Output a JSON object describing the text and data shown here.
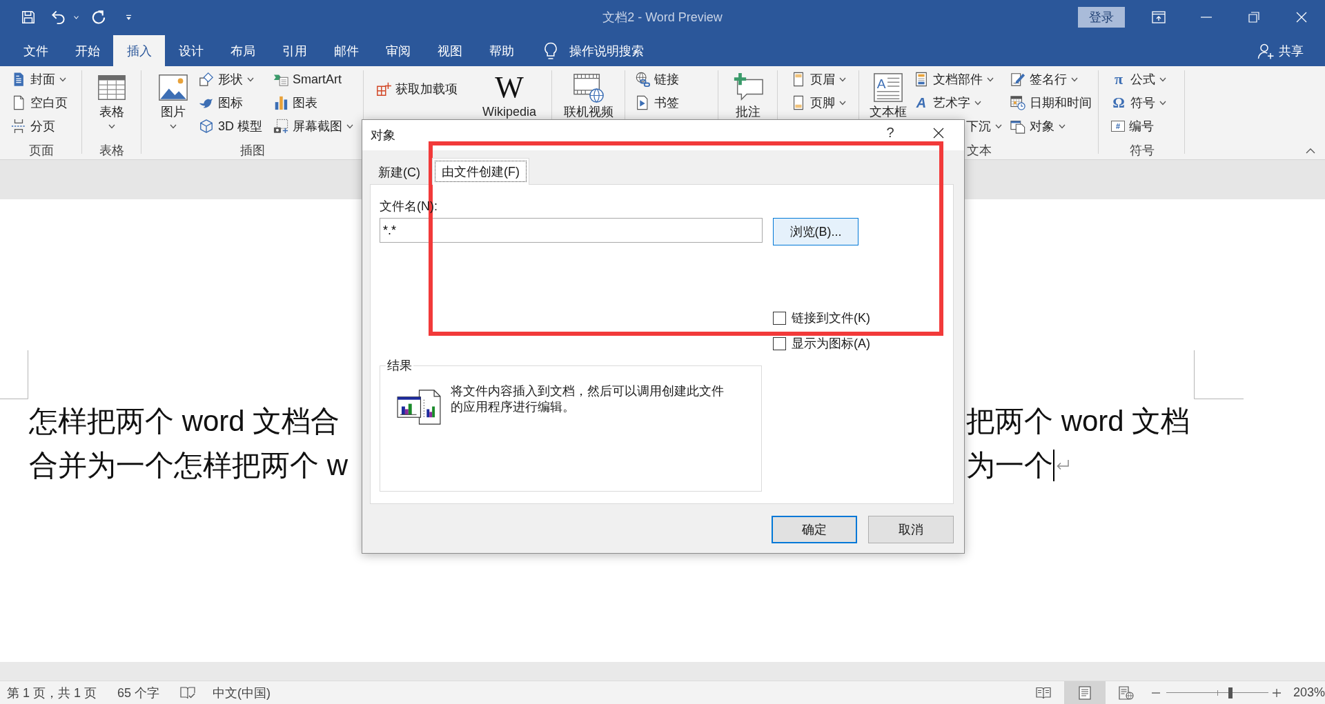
{
  "title_bar": {
    "title": "文档2 - Word Preview",
    "sign_in": "登录"
  },
  "menu_tabs": [
    {
      "label": "文件",
      "selected": false
    },
    {
      "label": "开始",
      "selected": false
    },
    {
      "label": "插入",
      "selected": true
    },
    {
      "label": "设计",
      "selected": false
    },
    {
      "label": "布局",
      "selected": false
    },
    {
      "label": "引用",
      "selected": false
    },
    {
      "label": "邮件",
      "selected": false
    },
    {
      "label": "审阅",
      "selected": false
    },
    {
      "label": "视图",
      "selected": false
    },
    {
      "label": "帮助",
      "selected": false
    }
  ],
  "tell_me": "操作说明搜索",
  "share": "共享",
  "ribbon": {
    "groups": [
      {
        "label": "页面",
        "columns": [
          [
            {
              "kind": "small",
              "label": "封面",
              "dropdown": true
            },
            {
              "kind": "small",
              "label": "空白页",
              "dropdown": false
            },
            {
              "kind": "small",
              "label": "分页",
              "dropdown": false
            }
          ]
        ]
      },
      {
        "label": "表格",
        "columns": [
          [
            {
              "kind": "large",
              "label": "表格",
              "dropdown": true
            }
          ]
        ]
      },
      {
        "label": "插图",
        "columns": [
          [
            {
              "kind": "large",
              "label": "图片",
              "dropdown": true
            }
          ],
          [
            {
              "kind": "small",
              "label": "形状",
              "dropdown": true
            },
            {
              "kind": "small",
              "label": "图标",
              "dropdown": false
            },
            {
              "kind": "small",
              "label": "3D 模型",
              "dropdown": false
            }
          ],
          [
            {
              "kind": "small",
              "label": "SmartArt",
              "dropdown": false
            },
            {
              "kind": "small",
              "label": "图表",
              "dropdown": false
            },
            {
              "kind": "small",
              "label": "屏幕截图",
              "dropdown": true
            }
          ]
        ]
      },
      {
        "columns": [
          [
            {
              "kind": "small",
              "label": "获取加载项",
              "dropdown": false
            }
          ],
          [
            {
              "kind": "large",
              "label": "Wikipedia",
              "dropdown": false,
              "glyph": "W"
            }
          ]
        ]
      },
      {
        "columns": [
          [
            {
              "kind": "large",
              "label": "联机视频",
              "dropdown": false
            }
          ]
        ]
      },
      {
        "columns": [
          [
            {
              "kind": "small",
              "label": "链接",
              "dropdown": false
            },
            {
              "kind": "small",
              "label": "书签",
              "dropdown": false
            }
          ]
        ]
      },
      {
        "columns": [
          [
            {
              "kind": "large",
              "label": "批注",
              "dropdown": false
            }
          ]
        ]
      },
      {
        "columns": [
          [
            {
              "kind": "small",
              "label": "页眉",
              "dropdown": true
            },
            {
              "kind": "small",
              "label": "页脚",
              "dropdown": true
            }
          ]
        ]
      },
      {
        "label": "文本",
        "columns": [
          [
            {
              "kind": "large",
              "label": "文本框",
              "dropdown": false,
              "glyph": "A"
            }
          ],
          [
            {
              "kind": "small",
              "label": "文档部件",
              "dropdown": true
            },
            {
              "kind": "small",
              "label": "艺术字",
              "dropdown": true,
              "glyph": "A"
            },
            {
              "kind": "partial",
              "label": "下沉",
              "dropdown": true
            }
          ],
          [
            {
              "kind": "small",
              "label": "签名行",
              "dropdown": true
            },
            {
              "kind": "small",
              "label": "日期和时间",
              "dropdown": false
            },
            {
              "kind": "small",
              "label": "对象",
              "dropdown": true
            }
          ]
        ]
      },
      {
        "label": "符号",
        "columns": [
          [
            {
              "kind": "small",
              "label": "公式",
              "dropdown": true,
              "glyph": "π"
            },
            {
              "kind": "small",
              "label": "符号",
              "dropdown": true,
              "glyph": "Ω"
            },
            {
              "kind": "small",
              "label": "编号",
              "dropdown": false,
              "glyph": "#"
            }
          ]
        ]
      }
    ]
  },
  "document": {
    "lines": [
      {
        "left": "怎样把两个 word 文档合",
        "right": "把两个 word 文档",
        "cursor": false,
        "paragraph_mark": false
      },
      {
        "left": "合并为一个怎样把两个 w",
        "right": "为一个",
        "cursor": true,
        "paragraph_mark": true
      }
    ]
  },
  "dialog": {
    "title": "对象",
    "help": "?",
    "tabs": [
      {
        "label": "新建(C)",
        "selected": false
      },
      {
        "label": "由文件创建(F)",
        "selected": true
      }
    ],
    "file_name": {
      "label": "文件名(N):",
      "value": "*.*"
    },
    "browse": "浏览(B)...",
    "checkboxes": [
      {
        "label": "链接到文件(K)",
        "checked": false
      },
      {
        "label": "显示为图标(A)",
        "checked": false
      }
    ],
    "result": {
      "legend": "结果",
      "description": "将文件内容插入到文档，然后可以调用创建此文件的应用程序进行编辑。"
    },
    "buttons": [
      {
        "label": "确定",
        "default": true
      },
      {
        "label": "取消",
        "default": false
      }
    ]
  },
  "status_bar": {
    "page": "第 1 页，共 1 页",
    "words": "65 个字",
    "language": "中文(中国)",
    "views": [
      {
        "selected": false
      },
      {
        "selected": true
      },
      {
        "selected": false
      }
    ],
    "zoom": {
      "level": 0.63,
      "reading": "203%"
    }
  }
}
